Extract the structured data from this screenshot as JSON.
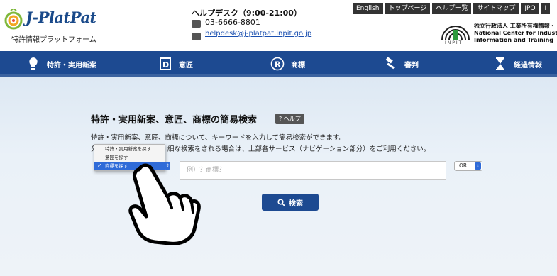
{
  "header": {
    "logo_text": "J-PlatPat",
    "logo_sub": "特許情報プラットフォーム",
    "helpdesk_title": "ヘルプデスク（9:00-21:00）",
    "helpdesk_phone": "03-6666-8801",
    "helpdesk_email": "helpdesk@j-platpat.inpit.go.jp",
    "top_links": [
      "English",
      "トップページ",
      "ヘルプ一覧",
      "サイトマップ",
      "JPO",
      "I"
    ],
    "inpit_label": "INPIT",
    "inpit_line1": "独立行政法人 工業所有権情報・",
    "inpit_line2": "National Center for Industrial P",
    "inpit_line3": "Information and Training"
  },
  "nav": {
    "items": [
      {
        "label": "特許・実用新案",
        "icon": "lightbulb-icon"
      },
      {
        "label": "意匠",
        "icon": "design-d-icon"
      },
      {
        "label": "商標",
        "icon": "registered-r-icon"
      },
      {
        "label": "審判",
        "icon": "gavel-icon"
      },
      {
        "label": "経過情報",
        "icon": "hourglass-icon"
      }
    ]
  },
  "search": {
    "title": "特許・実用新案、意匠、商標の簡易検索",
    "help_label": "? ヘルプ",
    "desc1": "特許・実用新案、意匠、商標について、キーワードを入力して簡易検索ができます。",
    "desc2_lead": "分",
    "desc2": "細な検索をされる場合は、上部各サービス（ナビゲーション部分）をご利用ください。",
    "dropdown_options": [
      "特許・実用新案を探す",
      "意匠を探す",
      "商標を探す"
    ],
    "dropdown_selected_index": 2,
    "placeholder": "例）？商標？",
    "operator": "OR",
    "button_label": "検索"
  },
  "colors": {
    "nav_bg": "#1d4a91",
    "select_highlight": "#2f6bd8"
  }
}
